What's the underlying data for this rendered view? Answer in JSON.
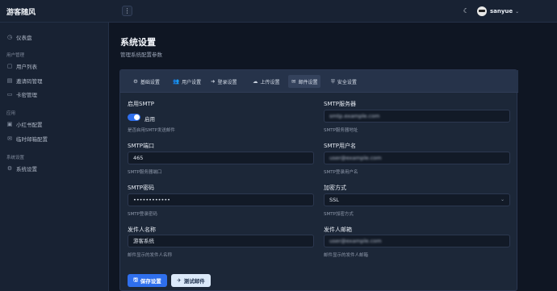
{
  "app": {
    "brand": "游客随风"
  },
  "topbar": {
    "menu_icon": "⋮",
    "theme_icon": "☾",
    "user": {
      "name": "sanyue",
      "caret": "⌄"
    }
  },
  "sidebar": {
    "dashboard": {
      "icon": "◷",
      "label": "仪表盘"
    },
    "groups": [
      {
        "title": "用户管理",
        "items": [
          {
            "icon": "▢",
            "label": "用户列表"
          },
          {
            "icon": "▤",
            "label": "邀请码管理"
          },
          {
            "icon": "▭",
            "label": "卡密管理"
          }
        ]
      },
      {
        "title": "应用",
        "items": [
          {
            "icon": "▣",
            "label": "小红书配置"
          },
          {
            "icon": "✉",
            "label": "临时邮箱配置"
          }
        ]
      },
      {
        "title": "系统设置",
        "items": [
          {
            "icon": "⚙",
            "label": "系统设置"
          }
        ]
      }
    ]
  },
  "page": {
    "title": "系统设置",
    "subtitle": "管理系统配置参数"
  },
  "tabs": [
    {
      "icon": "⚙",
      "label": "基础设置"
    },
    {
      "icon": "👥",
      "label": "用户设置"
    },
    {
      "icon": "➜",
      "label": "登录设置"
    },
    {
      "icon": "☁",
      "label": "上传设置"
    },
    {
      "icon": "✉",
      "label": "邮件设置"
    },
    {
      "icon": "⛨",
      "label": "安全设置"
    }
  ],
  "active_tab": "邮件设置",
  "form": {
    "enable_smtp": {
      "label": "启用SMTP",
      "toggle_label": "启用",
      "help": "是否启用SMTP发送邮件",
      "enabled": true
    },
    "smtp_server": {
      "label": "SMTP服务器",
      "value": "smtp.example.com",
      "help": "SMTP服务器地址"
    },
    "smtp_port": {
      "label": "SMTP端口",
      "value": "465",
      "help": "SMTP服务器端口"
    },
    "smtp_user": {
      "label": "SMTP用户名",
      "value": "user@example.com",
      "help": "SMTP登录用户名"
    },
    "smtp_password": {
      "label": "SMTP密码",
      "value": "••••••••••••",
      "help": "SMTP登录密码"
    },
    "encryption": {
      "label": "加密方式",
      "value": "SSL",
      "help": "SMTP加密方式",
      "caret": "⌄"
    },
    "sender_name": {
      "label": "发件人名称",
      "value": "游客系统",
      "help": "邮件显示的发件人名称"
    },
    "sender_email": {
      "label": "发件人邮箱",
      "value": "user@example.com",
      "help": "邮件显示的发件人邮箱"
    }
  },
  "actions": {
    "save": {
      "icon": "🖫",
      "label": "保存设置"
    },
    "test": {
      "icon": "✈",
      "label": "测试邮件"
    }
  },
  "colors": {
    "accent": "#2f6fed",
    "background": "#0f1623",
    "card": "#1c2738"
  }
}
